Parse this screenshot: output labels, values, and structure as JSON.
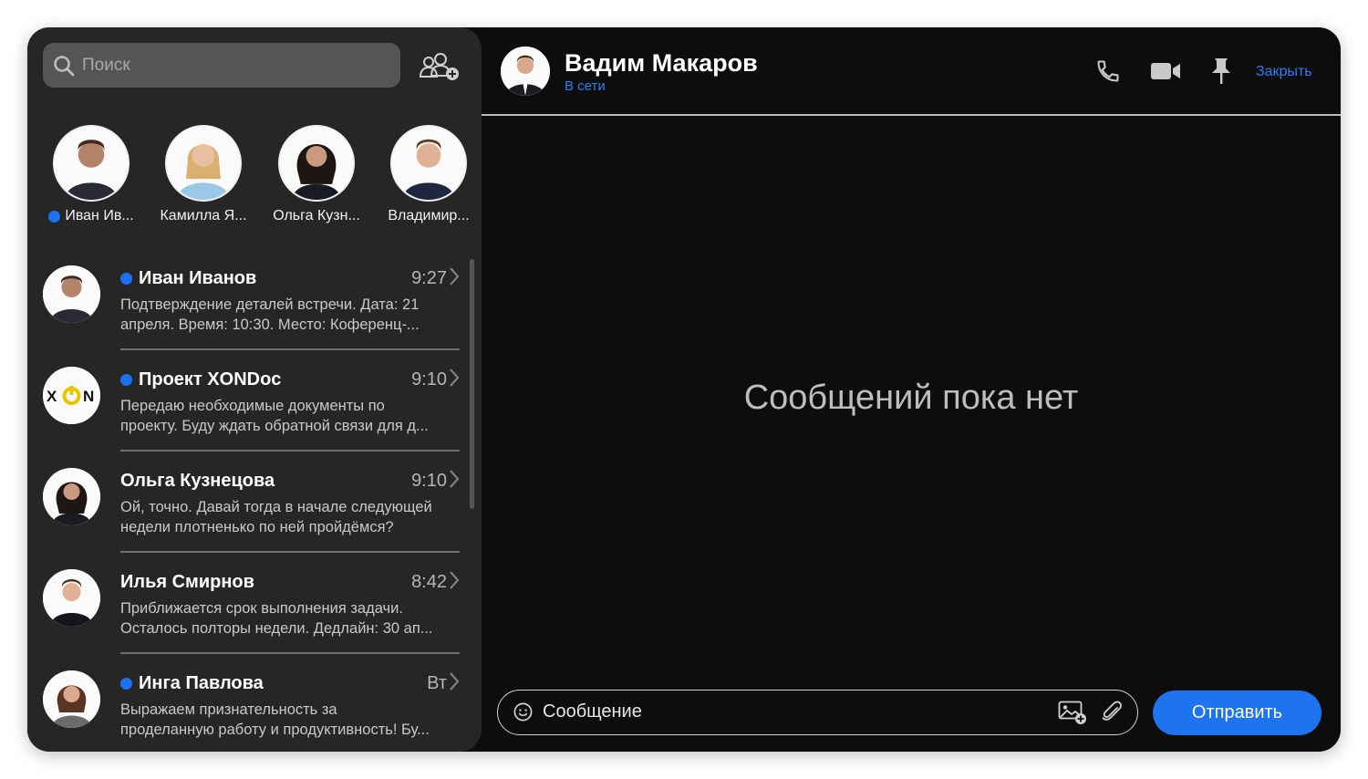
{
  "search": {
    "placeholder": "Поиск"
  },
  "stories": [
    {
      "name": "Иван Ив...",
      "online": true
    },
    {
      "name": "Камилла Я...",
      "online": false
    },
    {
      "name": "Ольга Кузн...",
      "online": false
    },
    {
      "name": "Владимир...",
      "online": false
    }
  ],
  "chats": [
    {
      "name": "Иван Иванов",
      "time": "9:27",
      "online": true,
      "preview_line1": "Подтверждение деталей встречи. Дата: 21",
      "preview_line2": "апреля. Время: 10:30. Место: Коференц-..."
    },
    {
      "name": "Проект XONDoc",
      "time": "9:10",
      "online": true,
      "preview_line1": "Передаю необходимые документы по",
      "preview_line2": "проекту. Буду ждать обратной связи для д..."
    },
    {
      "name": "Ольга Кузнецова",
      "time": "9:10",
      "online": false,
      "preview_line1": "Ой, точно. Давай тогда в начале следующей",
      "preview_line2": "недели плотненько по ней пройдёмся?"
    },
    {
      "name": "Илья Смирнов",
      "time": "8:42",
      "online": false,
      "preview_line1": "Приближается срок выполнения задачи.",
      "preview_line2": "Осталось полторы недели. Дедлайн: 30 ап..."
    },
    {
      "name": "Инга Павлова",
      "time": "Вт",
      "online": true,
      "preview_line1": "Выражаем признательность за",
      "preview_line2": "проделанную работу и продуктивность! Бу..."
    }
  ],
  "header": {
    "name": "Вадим Макаров",
    "status": "В сети",
    "close_label": "Закрыть"
  },
  "main": {
    "empty_text": "Сообщений пока нет"
  },
  "composer": {
    "placeholder": "Сообщение",
    "send_label": "Отправить"
  },
  "colors": {
    "accent": "#1e74ef",
    "online": "#1d72f2",
    "sidebar": "#262626",
    "background": "#0d0d0d"
  }
}
